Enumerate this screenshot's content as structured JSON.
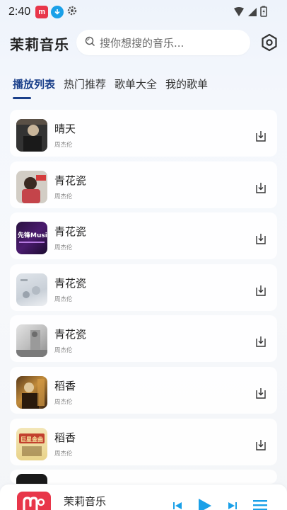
{
  "status_bar": {
    "time": "2:40",
    "app_icon_text": "m"
  },
  "header": {
    "title": "茉莉音乐",
    "search_placeholder": "搜你想搜的音乐..."
  },
  "tabs": [
    {
      "label": "播放列表",
      "active": true
    },
    {
      "label": "热门推荐",
      "active": false
    },
    {
      "label": "歌单大全",
      "active": false
    },
    {
      "label": "我的歌单",
      "active": false
    }
  ],
  "songs": [
    {
      "title": "晴天",
      "artist": "周杰伦"
    },
    {
      "title": "青花瓷",
      "artist": "周杰伦"
    },
    {
      "title": "青花瓷",
      "artist": "周杰伦"
    },
    {
      "title": "青花瓷",
      "artist": "周杰伦"
    },
    {
      "title": "青花瓷",
      "artist": "周杰伦"
    },
    {
      "title": "稻香",
      "artist": "周杰伦"
    },
    {
      "title": "稻香",
      "artist": "周杰伦"
    }
  ],
  "cover_badge_text": "先锋Music",
  "cover_banner_text": "巨星金曲",
  "player": {
    "title": "茉莉音乐"
  },
  "colors": {
    "accent": "#1a3f8a",
    "brand_red": "#e8364a",
    "play_blue": "#1aa0e8"
  }
}
